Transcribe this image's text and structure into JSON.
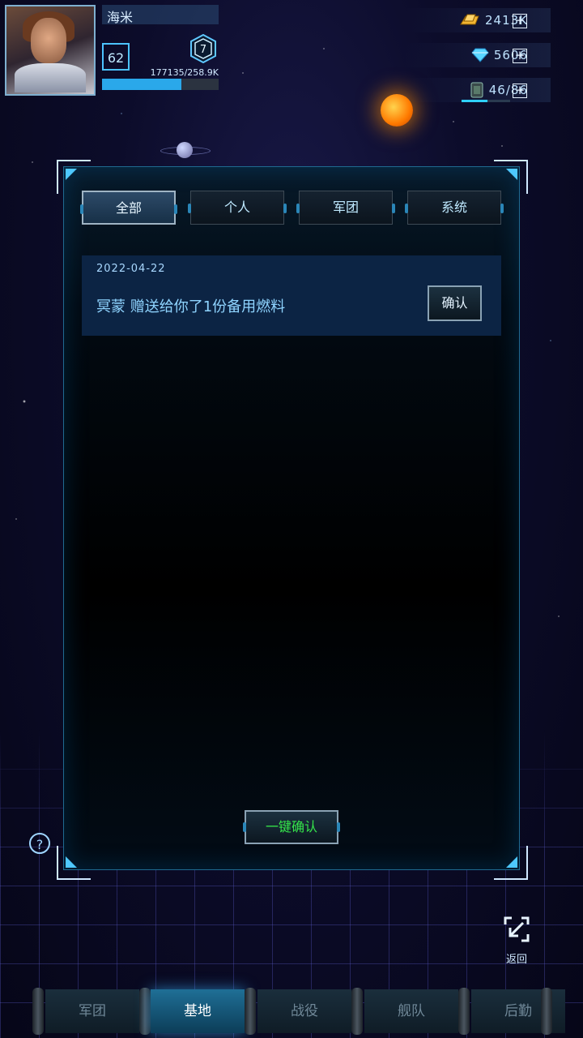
{
  "player": {
    "name": "海米",
    "level": "62",
    "rank": "7",
    "exp_text": "177135/258.9K",
    "exp_fraction": 0.68
  },
  "resources": {
    "gold": "2413K",
    "diamond": "5606",
    "fuel": "46/86",
    "fuel_fraction": 0.53
  },
  "mail": {
    "tabs": [
      "全部",
      "个人",
      "军团",
      "系统"
    ],
    "active_tab": 0,
    "messages": [
      {
        "date": "2022-04-22",
        "text": "冥蒙 赠送给你了1份备用燃料",
        "action": "确认"
      }
    ],
    "confirm_all": "一键确认"
  },
  "back_label": "返回",
  "nav": {
    "items": [
      "军团",
      "基地",
      "战役",
      "舰队",
      "后勤"
    ],
    "active": 1
  },
  "colors": {
    "accent": "#2aa8ea",
    "confirm_all_text": "#35e64a",
    "panel_border": "#1f6a90"
  }
}
